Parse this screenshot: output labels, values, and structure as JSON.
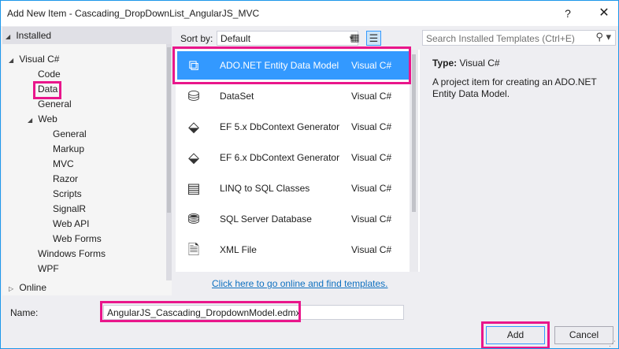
{
  "title": "Add New Item - Cascading_DropDownList_AngularJS_MVC",
  "title_buttons": {
    "help": "?",
    "close": "✕"
  },
  "tree": {
    "header": "Installed",
    "items": [
      {
        "label": "Visual C#",
        "expanded": true
      },
      {
        "label": "Code"
      },
      {
        "label": "Data",
        "selected": true
      },
      {
        "label": "General"
      },
      {
        "label": "Web",
        "expanded": true
      },
      {
        "label": "General"
      },
      {
        "label": "Markup"
      },
      {
        "label": "MVC"
      },
      {
        "label": "Razor"
      },
      {
        "label": "Scripts"
      },
      {
        "label": "SignalR"
      },
      {
        "label": "Web API"
      },
      {
        "label": "Web Forms"
      },
      {
        "label": "Windows Forms"
      },
      {
        "label": "WPF"
      },
      {
        "label": "Online",
        "expanded": false
      }
    ]
  },
  "sort": {
    "label": "Sort by:",
    "value": "Default"
  },
  "templates": [
    {
      "name": "ADO.NET Entity Data Model",
      "lang": "Visual C#",
      "icon": "entity-model-icon",
      "selected": true
    },
    {
      "name": "DataSet",
      "lang": "Visual C#",
      "icon": "dataset-icon"
    },
    {
      "name": "EF 5.x DbContext Generator",
      "lang": "Visual C#",
      "icon": "ef-generator-icon"
    },
    {
      "name": "EF 6.x DbContext Generator",
      "lang": "Visual C#",
      "icon": "ef-generator-icon"
    },
    {
      "name": "LINQ to SQL Classes",
      "lang": "Visual C#",
      "icon": "linq-icon"
    },
    {
      "name": "SQL Server Database",
      "lang": "Visual C#",
      "icon": "database-icon"
    },
    {
      "name": "XML File",
      "lang": "Visual C#",
      "icon": "xml-file-icon"
    }
  ],
  "online_link": "Click here to go online and find templates.",
  "search": {
    "placeholder": "Search Installed Templates (Ctrl+E)"
  },
  "details": {
    "type_label": "Type:",
    "type_value": "Visual C#",
    "description": "A project item for creating an ADO.NET Entity Data Model."
  },
  "name": {
    "label": "Name:",
    "value": "AngularJS_Cascading_DropdownModel.edmx"
  },
  "buttons": {
    "add": "Add",
    "cancel": "Cancel"
  },
  "colors": {
    "accent": "#3399ff",
    "highlight": "#e9168b",
    "link": "#0e70c0"
  }
}
